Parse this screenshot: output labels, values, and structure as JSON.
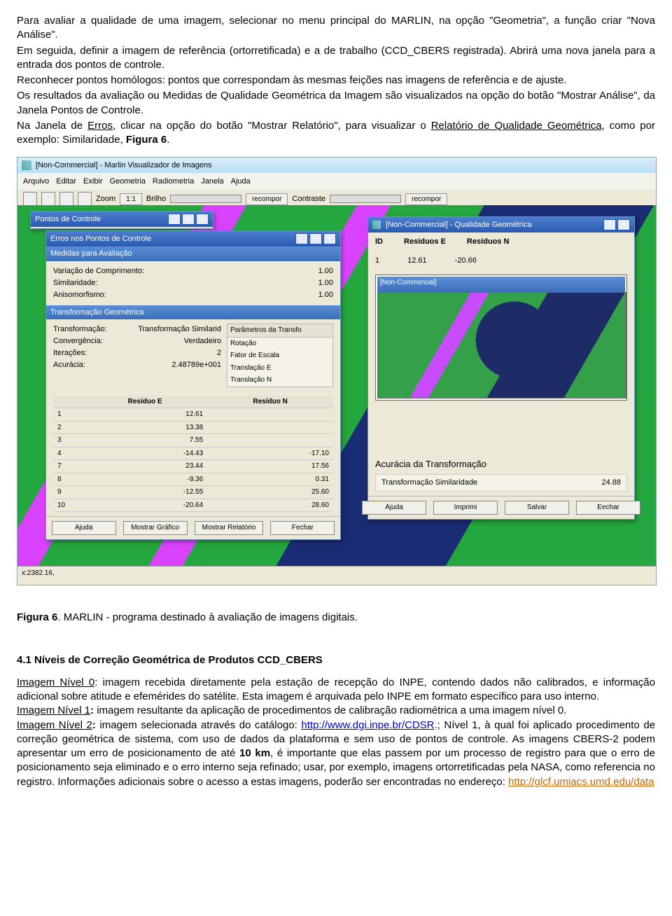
{
  "intro": {
    "p1": "Para avaliar a qualidade de uma imagem, selecionar no menu principal do MARLIN, na opção \"Geometria\", a função criar \"Nova Análise\".",
    "p2": "Em seguida, definir a imagem de referência (ortorretificada) e a de trabalho (CCD_CBERS registrada). Abrirá uma nova janela para a entrada dos pontos de controle.",
    "p3": "Reconhecer pontos homólogos: pontos que correspondam às mesmas feições nas imagens de referência e de ajuste.",
    "p4": "Os resultados da avaliação ou Medidas de Qualidade Geométrica da Imagem são visualizados na opção do botão \"Mostrar Análise\", da Janela Pontos de Controle.",
    "p5a": "Na Janela de ",
    "p5u": "Erros",
    "p5b": ", clicar na opção do botão \"Mostrar Relatório\", para visualizar o ",
    "p5u2": "Relatório de Qualidade Geométrica",
    "p5c": ", como por exemplo: Similaridade, ",
    "p5bold": "Figura 6",
    "p5d": "."
  },
  "app": {
    "title": "[Non-Commercial] - Marlin Visualizador de Imagens",
    "menu": [
      "Arquivo",
      "Editar",
      "Exibir",
      "Geometria",
      "Radiometria",
      "Janela",
      "Ajuda"
    ],
    "toolbar": {
      "zoom": "Zoom",
      "ratio": "1:1",
      "brilho": "Brilho",
      "recompor1": "recompor",
      "contraste": "Contraste",
      "recompor2": "recompor"
    },
    "status": "x:2382.16,"
  },
  "pontos": {
    "title": "Pontos de Controle"
  },
  "erros": {
    "title": "Erros nos Pontos de Controle",
    "sec1": "Medidas para Avaliação",
    "m1l": "Variação de Comprimento:",
    "m1v": "1.00",
    "m2l": "Similaridade:",
    "m2v": "1.00",
    "m3l": "Anisomorfismo:",
    "m3v": "1.00",
    "sec2": "Transformação Geométrica",
    "t1l": "Transformação:",
    "t1v": "Transformação Similarid",
    "t2l": "Convergência:",
    "t2v": "Verdadeiro",
    "t3l": "Iterações:",
    "t3v": "2",
    "t4l": "Acurácia:",
    "t4v": "2.48789e+001",
    "paramTitle": "Parâmetros da Transfo",
    "params": [
      "Rotação",
      "Fator de Escala",
      "Translação E",
      "Translação N"
    ],
    "residHead": [
      "",
      "Resíduo E",
      "Resíduo N"
    ],
    "resid": [
      {
        "n": "1",
        "e": "12.61",
        "w": ""
      },
      {
        "n": "2",
        "e": "13.38",
        "w": ""
      },
      {
        "n": "3",
        "e": "7.55",
        "w": ""
      },
      {
        "n": "4",
        "e": "-14.43",
        "w": "-17.10"
      },
      {
        "n": "7",
        "e": "23.44",
        "w": "17.56"
      },
      {
        "n": "8",
        "e": "-9.36",
        "w": "0.31"
      },
      {
        "n": "9",
        "e": "-12.55",
        "w": "25.60"
      },
      {
        "n": "10",
        "e": "-20.64",
        "w": "28.60"
      }
    ],
    "btnAjuda": "Ajuda",
    "btnGraf": "Mostrar Gráfico",
    "btnRel": "Mostrar Relatório",
    "btnFechar": "Fechar"
  },
  "qualidade": {
    "title": "[Non-Commercial] - Qualidade Geométrica",
    "hId": "ID",
    "hE": "Resíduos E",
    "hN": "Resíduos N",
    "rId": "1",
    "rE": "12.61",
    "rN": "-20.66",
    "secAc": "Acurácia da Transformação",
    "acLabel": "Transformação Similaridade",
    "acVal": "24.88",
    "btnAjuda": "Ajuda",
    "btnImpr": "Imprimi",
    "btnSalvar": "Salvar",
    "btnFechar": "Eechar"
  },
  "caption": {
    "bold": "Figura 6",
    "rest": ". MARLIN - programa destinado à avaliação de imagens digitais."
  },
  "section": {
    "heading": "4.1 Níveis de Correção Geométrica de Produtos CCD_CBERS",
    "n0u": "Imagem Nível 0",
    "n0": ": imagem recebida diretamente pela estação de recepção do INPE, contendo dados não calibrados, e informação adicional sobre atitude e efemérides do satélite. Esta imagem é arquivada pelo INPE em formato específico para uso interno.",
    "n1u": "Imagem Nível 1",
    "n1b": ":",
    "n1": " imagem resultante da aplicação de procedimentos de calibração radiométrica a uma imagem nível 0.",
    "n2u": "Imagem Nível 2",
    "n2b": ":",
    "n2a": " imagem selecionada através do catálogo: ",
    "n2link": "http://www.dgi.inpe.br/CDSR",
    "n2c": ".; Nível 1, à qual foi aplicado procedimento de correção geométrica de sistema, com uso de dados da plataforma e sem uso de pontos de controle. As imagens CBERS-2 podem apresentar um erro de posicionamento de até ",
    "n2bold": "10 km",
    "n2d": ", é importante que elas passem por um processo de registro para que o erro de posicionamento seja eliminado e o erro interno seja refinado; usar, por exemplo, imagens ortorretificadas pela NASA, como referencia no registro. Informações adicionais sobre o acesso a estas imagens, poderão ser encontradas no endereço: ",
    "n2link2": "http://glcf.umiacs.umd.edu/data"
  }
}
